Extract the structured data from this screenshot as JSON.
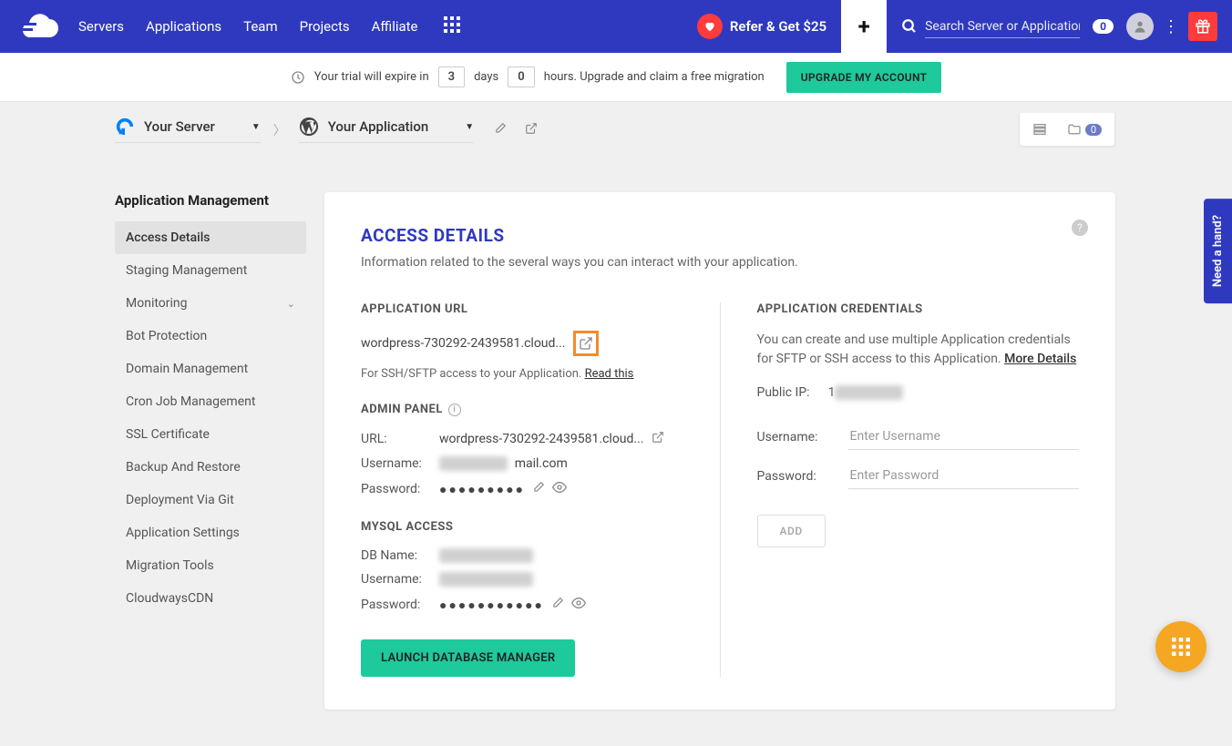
{
  "header": {
    "nav": [
      "Servers",
      "Applications",
      "Team",
      "Projects",
      "Affiliate"
    ],
    "refer_label": "Refer & Get $25",
    "search_placeholder": "Search Server or Application",
    "search_count": "0"
  },
  "trial": {
    "prefix": "Your trial will expire in",
    "days_num": "3",
    "days_label": "days",
    "hours_num": "0",
    "hours_label": "hours. Upgrade and claim a free migration",
    "upgrade_btn": "UPGRADE MY ACCOUNT"
  },
  "breadcrumb": {
    "server": "Your Server",
    "app": "Your Application",
    "folder_count": "0"
  },
  "sidebar": {
    "title": "Application Management",
    "items": [
      {
        "label": "Access Details",
        "active": true
      },
      {
        "label": "Staging Management"
      },
      {
        "label": "Monitoring",
        "expandable": true
      },
      {
        "label": "Bot Protection"
      },
      {
        "label": "Domain Management"
      },
      {
        "label": "Cron Job Management"
      },
      {
        "label": "SSL Certificate"
      },
      {
        "label": "Backup And Restore"
      },
      {
        "label": "Deployment Via Git"
      },
      {
        "label": "Application Settings"
      },
      {
        "label": "Migration Tools"
      },
      {
        "label": "CloudwaysCDN"
      }
    ]
  },
  "page": {
    "title": "ACCESS DETAILS",
    "subtitle": "Information related to the several ways you can interact with your application."
  },
  "app_url": {
    "label": "APPLICATION URL",
    "url": "wordpress-730292-2439581.cloud...",
    "ssh_text": "For SSH/SFTP access to your Application. ",
    "read_this": "Read this"
  },
  "admin": {
    "label": "ADMIN PANEL",
    "url_label": "URL:",
    "url_val": "wordpress-730292-2439581.cloud...",
    "user_label": "Username:",
    "user_val_suffix": "mail.com",
    "pass_label": "Password:",
    "pass_dots": "●●●●●●●●●"
  },
  "mysql": {
    "label": "MYSQL ACCESS",
    "db_label": "DB Name:",
    "user_label": "Username:",
    "pass_label": "Password:",
    "pass_dots": "●●●●●●●●●●●",
    "launch_btn": "LAUNCH DATABASE MANAGER"
  },
  "creds": {
    "label": "APPLICATION CREDENTIALS",
    "desc": "You can create and use multiple Application credentials for SFTP or SSH access to this Application. ",
    "more": "More Details",
    "ip_label": "Public IP:",
    "ip_prefix": "1",
    "user_label": "Username:",
    "user_placeholder": "Enter Username",
    "pass_label": "Password:",
    "pass_placeholder": "Enter Password",
    "add_btn": "ADD"
  },
  "help_tab": "Need a hand?"
}
